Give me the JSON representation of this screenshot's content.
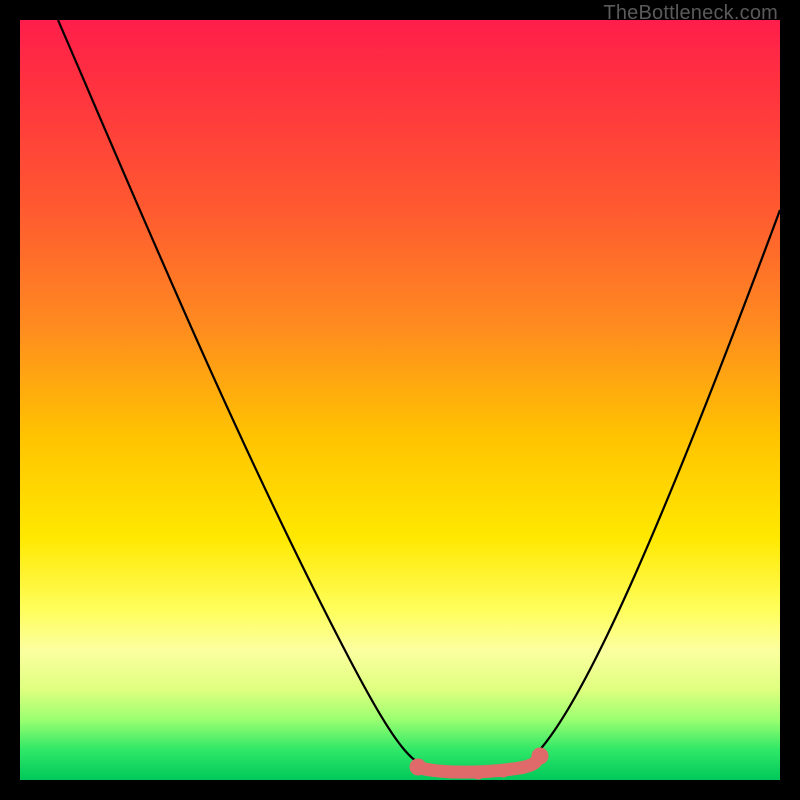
{
  "watermark": "TheBottleneck.com",
  "chart_data": {
    "type": "line",
    "title": "",
    "xlabel": "",
    "ylabel": "",
    "xlim": [
      0,
      100
    ],
    "ylim": [
      0,
      100
    ],
    "series": [
      {
        "name": "curve",
        "x": [
          5,
          10,
          15,
          20,
          25,
          30,
          35,
          40,
          45,
          50,
          53,
          55,
          58,
          60,
          63,
          66,
          70,
          75,
          80,
          85,
          90,
          95,
          100
        ],
        "y": [
          100,
          89,
          78,
          67,
          56,
          45,
          35,
          25,
          16,
          8,
          4,
          2,
          1,
          1,
          1,
          2,
          4,
          10,
          20,
          33,
          48,
          62,
          75
        ]
      }
    ],
    "flat_region": {
      "x_start": 53,
      "x_end": 67,
      "color": "#e26a6a"
    }
  }
}
